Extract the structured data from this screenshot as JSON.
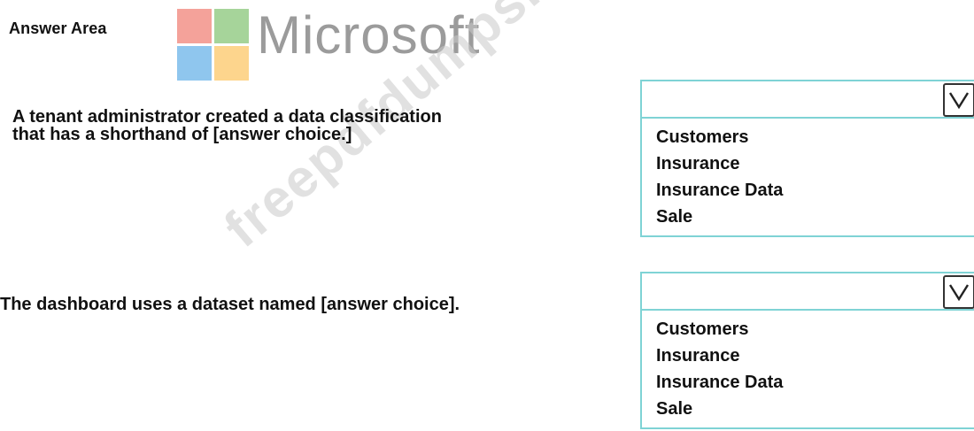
{
  "answer_area_label": "Answer Area",
  "brand": {
    "wordmark": "Microsoft",
    "logo_colors": [
      "#f4a29a",
      "#a6d49a",
      "#8fc6ee",
      "#fdd58d"
    ]
  },
  "watermark": "freepdfdumps.com",
  "questions": [
    {
      "line1": "A tenant administrator created a data classification",
      "line2": "that has a shorthand of [answer choice.]",
      "dropdown": {
        "selected": "",
        "options": [
          "Customers",
          "Insurance",
          "Insurance Data",
          "Sale"
        ]
      }
    },
    {
      "line1": "The dashboard uses a dataset named [answer choice].",
      "dropdown": {
        "selected": "",
        "options": [
          "Customers",
          "Insurance",
          "Insurance Data",
          "Sale"
        ]
      }
    }
  ],
  "accent_color": "#7fd3d5"
}
